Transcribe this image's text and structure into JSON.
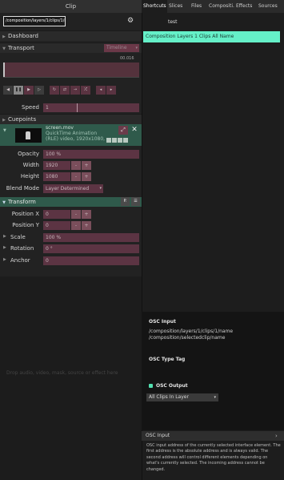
{
  "clip_panel": {
    "title": "Clip",
    "path": "/composition/layers/1/clips/1/name",
    "gear_icon": "gear-icon"
  },
  "sections": {
    "dashboard": "Dashboard",
    "transport": "Transport",
    "transport_mode": "Timeline",
    "timecode": "00.016",
    "speed_label": "Speed",
    "speed_value": "1",
    "cuepoints": "Cuepoints"
  },
  "clip_info": {
    "name": "screen.mov",
    "codec": "QuickTime Animation",
    "codec2": "(RLE) video, 1920x1080,"
  },
  "properties": {
    "opacity_label": "Opacity",
    "opacity_value": "100 %",
    "width_label": "Width",
    "width_value": "1920",
    "height_label": "Height",
    "height_value": "1080",
    "blend_label": "Blend Mode",
    "blend_value": "Layer Determined",
    "minus": "-",
    "plus": "+"
  },
  "transform": {
    "title": "Transform",
    "p_button": "P.",
    "pos_x_label": "Position X",
    "pos_x_value": "0",
    "pos_y_label": "Position Y",
    "pos_y_value": "0",
    "scale_label": "Scale",
    "scale_value": "100 %",
    "rotation_label": "Rotation",
    "rotation_value": "0 °",
    "anchor_label": "Anchor",
    "anchor_value": "0"
  },
  "drop_hint": "Drop audio, video, mask, source or effect here",
  "tabs": [
    "Shortcuts",
    "Slices",
    "Files",
    "Compositi...",
    "Effects",
    "Sources"
  ],
  "search": {
    "value": "test"
  },
  "search_result": "Composition Layers 1 Clips All Name",
  "osc": {
    "input_title": "OSC Input",
    "input_line1": "/composition/layers/1/clips/1/name",
    "input_line2": "/composition/selectedclip/name",
    "type_tag_title": "OSC Type Tag",
    "output_title": "OSC Output",
    "output_select": "All Clips In Layer"
  },
  "help": {
    "title": "OSC Input",
    "text": "OSC input address of the currently selected interface element. The first address is the absolute address and is always valid. The second address will control different elements depending on what's currently selected. The incoming address cannot be changed."
  },
  "colors": {
    "accent_green": "#2f5a4b",
    "accent_cyan": "#65f0c8",
    "field_plum": "#5c3443"
  }
}
